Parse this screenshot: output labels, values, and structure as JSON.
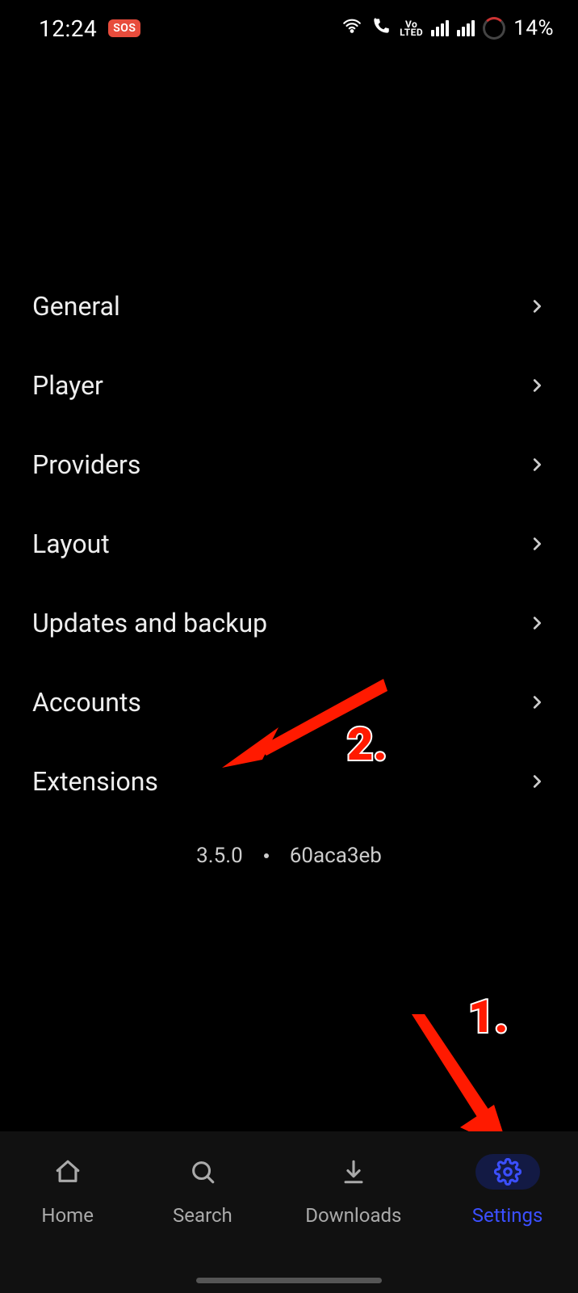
{
  "status": {
    "time": "12:24",
    "sos": "SOS",
    "volte_top": "Vo",
    "volte_bottom": "LTED",
    "battery": "14%"
  },
  "settings": {
    "items": [
      {
        "label": "General"
      },
      {
        "label": "Player"
      },
      {
        "label": "Providers"
      },
      {
        "label": "Layout"
      },
      {
        "label": "Updates and backup"
      },
      {
        "label": "Accounts"
      },
      {
        "label": "Extensions"
      }
    ],
    "version": "3.5.0",
    "commit": "60aca3eb"
  },
  "nav": {
    "items": [
      {
        "label": "Home",
        "icon": "home"
      },
      {
        "label": "Search",
        "icon": "search"
      },
      {
        "label": "Downloads",
        "icon": "download"
      },
      {
        "label": "Settings",
        "icon": "gear",
        "active": true
      }
    ]
  },
  "annotations": {
    "num1": "1.",
    "num2": "2."
  }
}
